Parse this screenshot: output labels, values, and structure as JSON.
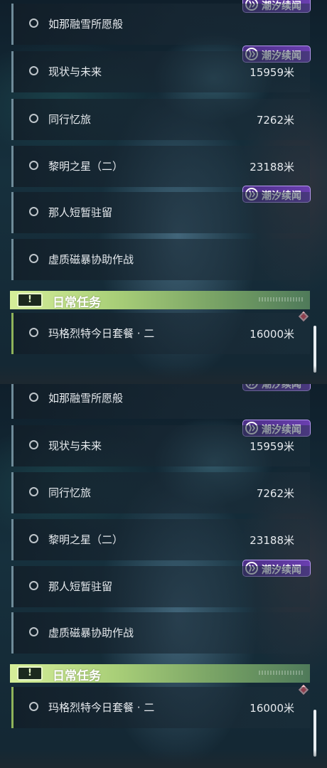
{
  "badge": {
    "label": "潮汐续闻"
  },
  "quests": [
    {
      "name": "如那融雪所愿般",
      "distance": ""
    },
    {
      "name": "现状与未来",
      "distance": "15959米"
    },
    {
      "name": "同行忆旅",
      "distance": "7262米"
    },
    {
      "name": "黎明之星（二）",
      "distance": "23188米"
    },
    {
      "name": "那人短暂驻留",
      "distance": ""
    },
    {
      "name": "虚质磁暴协助作战",
      "distance": ""
    }
  ],
  "daily": {
    "header_title": "日常任务",
    "header_icon": "!",
    "quest": {
      "name": "玛格烈特今日套餐 · 二",
      "distance": "16000米"
    }
  },
  "colors": {
    "badge": "#5a37a0",
    "daily_accent": "#b7d985",
    "marker": "#e14a5b"
  },
  "icons": {
    "radio": "circle-radio-icon",
    "badge": "tide-sparkle-icon",
    "daily": "exclamation-icon",
    "marker": "diamond-marker-icon"
  }
}
